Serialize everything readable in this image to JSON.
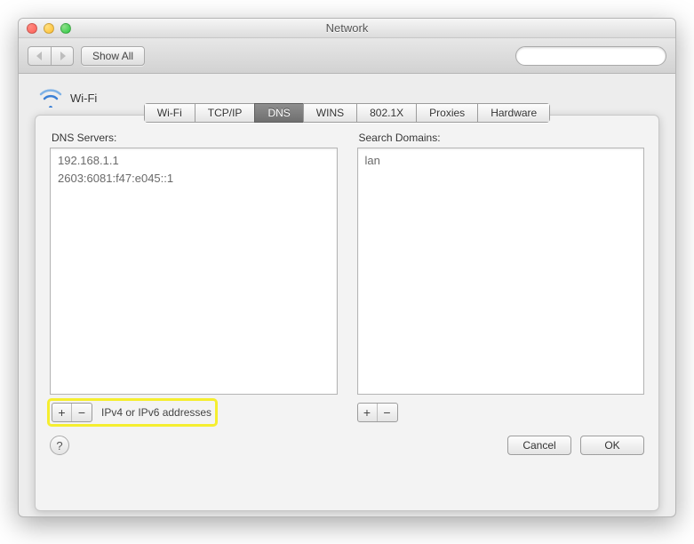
{
  "window": {
    "title": "Network"
  },
  "toolbar": {
    "show_all_label": "Show All",
    "search_placeholder": ""
  },
  "header": {
    "wifi_label": "Wi-Fi"
  },
  "tabs": [
    {
      "label": "Wi-Fi",
      "active": false
    },
    {
      "label": "TCP/IP",
      "active": false
    },
    {
      "label": "DNS",
      "active": true
    },
    {
      "label": "WINS",
      "active": false
    },
    {
      "label": "802.1X",
      "active": false
    },
    {
      "label": "Proxies",
      "active": false
    },
    {
      "label": "Hardware",
      "active": false
    }
  ],
  "dns": {
    "servers_label": "DNS Servers:",
    "servers": [
      "192.168.1.1",
      "2603:6081:f47:e045::1"
    ],
    "domains_label": "Search Domains:",
    "domains": [
      "lan"
    ],
    "hint": "IPv4 or IPv6 addresses",
    "plus": "+",
    "minus": "−"
  },
  "footer": {
    "help": "?",
    "cancel": "Cancel",
    "ok": "OK"
  }
}
